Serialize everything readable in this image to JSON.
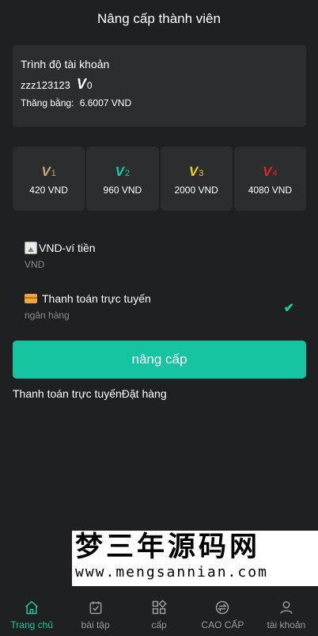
{
  "header": {
    "title": "Nâng cấp thành viên"
  },
  "account": {
    "title": "Trình độ tài khoản",
    "username": "zzz123123",
    "vip_letter": "V",
    "vip_level": "0",
    "balance_label": "Thăng bằng:",
    "balance_value": "6.6007 VND"
  },
  "levels": [
    {
      "letter": "V",
      "num": "1",
      "price": "420 VND",
      "color": "#c8a96a"
    },
    {
      "letter": "V",
      "num": "2",
      "price": "960 VND",
      "color": "#1cc9a4"
    },
    {
      "letter": "V",
      "num": "3",
      "price": "2000 VND",
      "color": "#f0d01a"
    },
    {
      "letter": "V",
      "num": "4",
      "price": "4080 VND",
      "color": "#e0281e"
    }
  ],
  "payment": {
    "wallet": {
      "title": "VND-ví tiền",
      "sub": "VND"
    },
    "online": {
      "title": "Thanh toán trực tuyến",
      "sub": "ngân hàng",
      "selected": true
    }
  },
  "actions": {
    "upgrade_label": "nâng cấp",
    "order_link": "Thanh toán trực tuyếnĐặt hàng"
  },
  "watermark": {
    "line1": "梦三年源码网",
    "line2": "www.mengsannian.com"
  },
  "tabbar": {
    "items": [
      {
        "label": "Trang chủ",
        "icon": "home-icon",
        "active": true
      },
      {
        "label": "bài tập",
        "icon": "task-icon",
        "active": false
      },
      {
        "label": "cấp",
        "icon": "grid-icon",
        "active": false
      },
      {
        "label": "CAO CẤP",
        "icon": "exchange-icon",
        "active": false
      },
      {
        "label": "tài khoản",
        "icon": "user-icon",
        "active": false
      }
    ]
  },
  "colors": {
    "accent": "#1cc9a4",
    "button": "#17c4a2",
    "background": "#1f2021",
    "card": "#2c2d2f"
  }
}
